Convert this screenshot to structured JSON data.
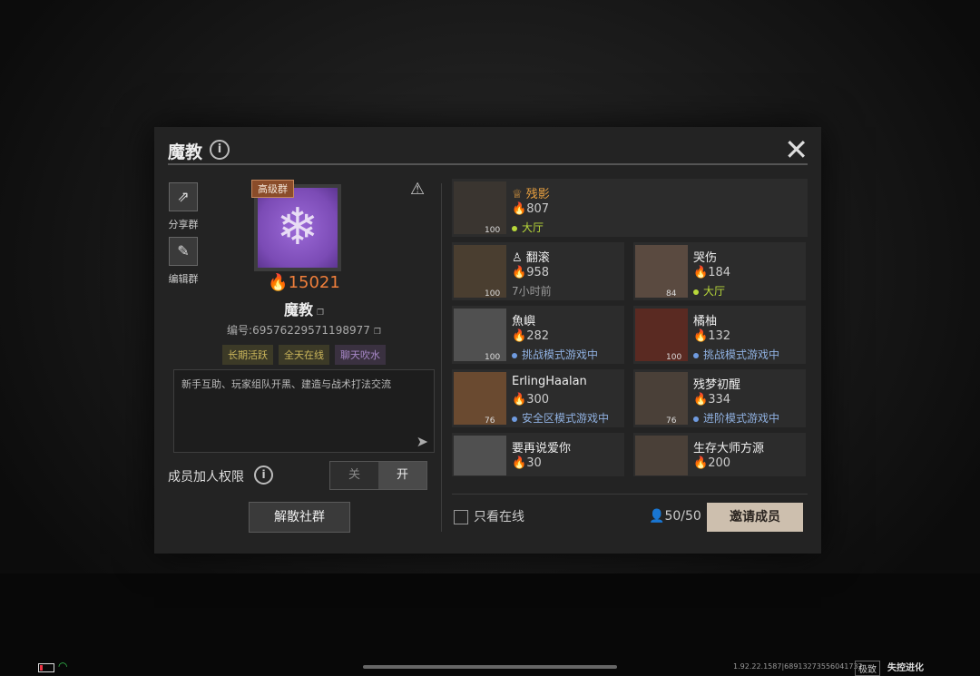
{
  "panel": {
    "title": "魔教",
    "left": {
      "share_label": "分享群",
      "edit_label": "编辑群",
      "tier_badge": "高级群",
      "heat": "15021",
      "group_name": "魔教",
      "group_id": "编号:69576229571198977",
      "tags": [
        "长期活跃",
        "全天在线",
        "聊天吹水"
      ],
      "description": "新手互助、玩家组队开黑、建造与战术打法交流",
      "permission_label": "成员加人权限",
      "toggle_off": "关",
      "toggle_on": "开",
      "dissolve_label": "解散社群"
    },
    "members": [
      {
        "name": "残影",
        "heat": "807",
        "status": "大厅",
        "level": "100",
        "status_color": "green",
        "is_leader": true
      },
      {
        "name": "翻滚",
        "heat": "958",
        "status": "7小时前",
        "level": "100",
        "status_color": "gray"
      },
      {
        "name": "哭伤",
        "heat": "184",
        "status": "大厅",
        "level": "84",
        "status_color": "green"
      },
      {
        "name": "魚嶼",
        "heat": "282",
        "status": "挑战模式游戏中",
        "level": "100",
        "status_color": "blue"
      },
      {
        "name": "橘柚",
        "heat": "132",
        "status": "挑战模式游戏中",
        "level": "100",
        "status_color": "blue"
      },
      {
        "name": "ErlingHaalan",
        "heat": "300",
        "status": "安全区模式游戏中",
        "level": "76",
        "status_color": "blue"
      },
      {
        "name": "残梦初醒",
        "heat": "334",
        "status": "进阶模式游戏中",
        "level": "76",
        "status_color": "blue"
      },
      {
        "name": "要再说爱你",
        "heat": "30",
        "status": "",
        "level": "",
        "status_color": "gray"
      },
      {
        "name": "生存大师方源",
        "heat": "200",
        "status": "",
        "level": "",
        "status_color": "gray"
      }
    ],
    "footer": {
      "online_only_label": "只看在线",
      "member_count": "50/50",
      "invite_label": "邀请成员"
    }
  },
  "system": {
    "version": "1.92.22.1587|68913273556041732",
    "quality": "极致",
    "brand": "失控进化"
  }
}
